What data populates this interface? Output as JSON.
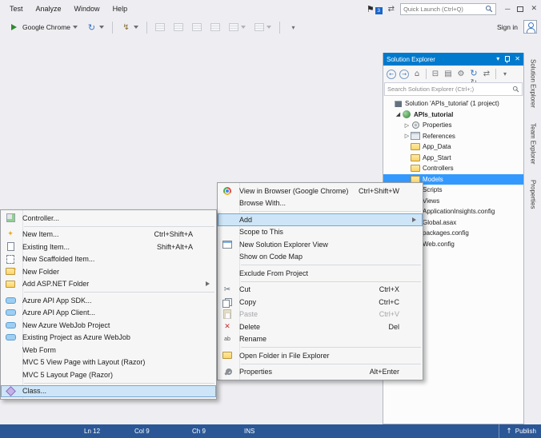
{
  "colors": {
    "accent": "#007acc",
    "selection": "#3399ff",
    "menu-highlight": "#cde5f7",
    "menu-bg": "#f6f6f6",
    "window-bg": "#eeeef2",
    "statusbar": "#2b5797"
  },
  "titlebar": {
    "menus": [
      "Test",
      "Analyze",
      "Window",
      "Help"
    ],
    "notification_count": "3",
    "quick_launch": "Quick Launch (Ctrl+Q)",
    "sign_in": "Sign in"
  },
  "toolbar": {
    "buttons": [
      {
        "icon": "play",
        "label": "Google Chrome",
        "caret": true
      },
      {
        "icon": "refresh",
        "caret": true
      },
      {
        "type": "sep"
      },
      {
        "icon": "bolt",
        "caret": true
      },
      {
        "type": "sep"
      },
      {
        "icon": "grid",
        "disabled": true
      },
      {
        "icon": "grid",
        "disabled": true
      },
      {
        "icon": "grid",
        "disabled": true
      },
      {
        "icon": "grid",
        "disabled": true
      },
      {
        "icon": "table",
        "caret": true,
        "disabled": true
      },
      {
        "icon": "table",
        "caret": true,
        "disabled": true
      },
      {
        "type": "sep"
      },
      {
        "icon": "overflow"
      }
    ]
  },
  "solution_explorer": {
    "title": "Solution Explorer",
    "search_placeholder": "Search Solution Explorer (Ctrl+;)",
    "toolbar_icons": [
      "back",
      "forward",
      "home",
      "sep",
      "collapse-all",
      "show-all-files",
      "properties-gear",
      "refresh",
      "sync",
      "sep",
      "caret"
    ],
    "tree": [
      {
        "label": "Solution 'APIs_tutorial' (1 project)",
        "level": 0,
        "icon": "solution",
        "expand": "none"
      },
      {
        "label": "APIs_tutorial",
        "level": 1,
        "icon": "project",
        "expand": "open",
        "bold": true
      },
      {
        "label": "Properties",
        "level": 2,
        "icon": "properties",
        "expand": "closed"
      },
      {
        "label": "References",
        "level": 2,
        "icon": "references",
        "expand": "closed"
      },
      {
        "label": "App_Data",
        "level": 2,
        "icon": "folder",
        "expand": "none"
      },
      {
        "label": "App_Start",
        "level": 2,
        "icon": "folder",
        "expand": "none"
      },
      {
        "label": "Controllers",
        "level": 2,
        "icon": "folder",
        "expand": "none"
      },
      {
        "label": "Models",
        "level": 2,
        "icon": "folder",
        "expand": "none",
        "selected": true
      },
      {
        "label": "Scripts",
        "level": 2,
        "icon": "folder",
        "expand": "none"
      },
      {
        "label": "Views",
        "level": 2,
        "icon": "folder",
        "expand": "none"
      },
      {
        "label": "ApplicationInsights.config",
        "level": 2,
        "icon": "appinsights",
        "expand": "none"
      },
      {
        "label": "Global.asax",
        "level": 2,
        "icon": "asax",
        "expand": "none"
      },
      {
        "label": "packages.config",
        "level": 2,
        "icon": "config",
        "expand": "none"
      },
      {
        "label": "Web.config",
        "level": 2,
        "icon": "config",
        "expand": "none"
      }
    ]
  },
  "side_tabs": [
    "Solution Explorer",
    "Team Explorer",
    "Properties"
  ],
  "context_menu": {
    "items": [
      {
        "label": "View in Browser (Google Chrome)",
        "shortcut": "Ctrl+Shift+W",
        "icon": "browser"
      },
      {
        "label": "Browse With..."
      },
      {
        "type": "separator"
      },
      {
        "label": "Add",
        "submenu": true,
        "highlight": true
      },
      {
        "label": "Scope to This"
      },
      {
        "label": "New Solution Explorer View",
        "icon": "new-view"
      },
      {
        "label": "Show on Code Map"
      },
      {
        "type": "separator"
      },
      {
        "label": "Exclude From Project"
      },
      {
        "type": "separator"
      },
      {
        "label": "Cut",
        "shortcut": "Ctrl+X",
        "icon": "cut"
      },
      {
        "label": "Copy",
        "shortcut": "Ctrl+C",
        "icon": "copy"
      },
      {
        "label": "Paste",
        "shortcut": "Ctrl+V",
        "icon": "paste",
        "disabled": true
      },
      {
        "label": "Delete",
        "shortcut": "Del",
        "icon": "delete"
      },
      {
        "label": "Rename",
        "icon": "rename"
      },
      {
        "type": "separator"
      },
      {
        "label": "Open Folder in File Explorer",
        "icon": "open-folder"
      },
      {
        "type": "separator"
      },
      {
        "label": "Properties",
        "shortcut": "Alt+Enter",
        "icon": "properties"
      }
    ]
  },
  "submenu": {
    "items": [
      {
        "label": "Controller...",
        "icon": "controller"
      },
      {
        "type": "separator"
      },
      {
        "label": "New Item...",
        "shortcut": "Ctrl+Shift+A",
        "icon": "new-item"
      },
      {
        "label": "Existing Item...",
        "shortcut": "Shift+Alt+A",
        "icon": "existing-item"
      },
      {
        "label": "New Scaffolded Item...",
        "icon": "scaffold"
      },
      {
        "label": "New Folder",
        "icon": "new-folder"
      },
      {
        "label": "Add ASP.NET Folder",
        "submenu": true,
        "icon": "open-folder"
      },
      {
        "type": "separator"
      },
      {
        "label": "Azure API App SDK...",
        "icon": "azure"
      },
      {
        "label": "Azure API App Client...",
        "icon": "azure"
      },
      {
        "label": "New Azure WebJob Project",
        "icon": "azure"
      },
      {
        "label": "Existing Project as Azure WebJob",
        "icon": "azure"
      },
      {
        "label": "Web Form"
      },
      {
        "label": "MVC 5 View Page with Layout (Razor)"
      },
      {
        "label": "MVC 5 Layout Page (Razor)"
      },
      {
        "type": "separator"
      },
      {
        "label": "Class...",
        "icon": "class",
        "highlight": true
      }
    ]
  },
  "statusbar": {
    "line": "Ln 12",
    "col": "Col 9",
    "ch": "Ch 9",
    "mode": "INS",
    "publish": "Publish"
  }
}
